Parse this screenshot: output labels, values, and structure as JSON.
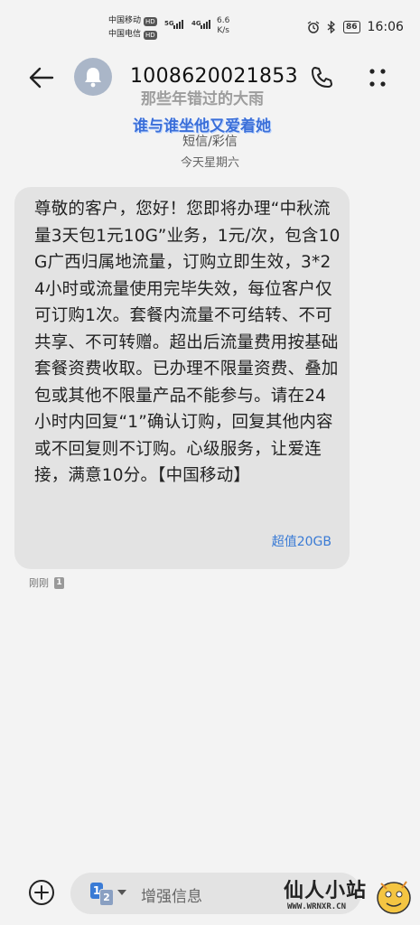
{
  "status_bar": {
    "carrier_1": "中国移动",
    "carrier_2": "中国电信",
    "hd_badge": "HD",
    "network_5g": "5G",
    "network_4g": "4G",
    "speed_value": "6.6",
    "speed_unit": "K/s",
    "battery_level": "86",
    "time": "16:06"
  },
  "header": {
    "phone_number": "1008620021853",
    "watermark_line1": "那些年错过的大雨",
    "watermark_line2": "谁与谁坐他又爱着她",
    "subtitle": "短信/彩信",
    "day_label": "今天星期六"
  },
  "message": {
    "text": "尊敬的客户，您好！您即将办理“中秋流量3天包1元10G”业务，1元/次，包含10G广西归属地流量，订购立即生效，3*24小时或流量使用完毕失效，每位客户仅可订购1次。套餐内流量不可结转、不可共享、不可转赠。超出后流量费用按基础套餐资费收取。已办理不限量资费、叠加包或其他不限量产品不能参与。请在24小时内回复“1”确认订购，回复其他内容或不回复则不订购。心级服务，让爱连接，满意10分。【中国移动】",
    "link_text": "超值20GB",
    "timestamp": "刚刚",
    "sim_slot": "1"
  },
  "compose": {
    "placeholder": "增强信息",
    "sim_1": "1",
    "sim_2": "2"
  },
  "watermark_logo": {
    "name": "仙人小站",
    "url": "WWW.WRNXR.CN"
  },
  "colors": {
    "background": "#f3f3f3",
    "bubble": "#e3e3e3",
    "link": "#3a7bd5",
    "avatar": "#aab6c8"
  },
  "icons": [
    "back-arrow-icon",
    "contact-avatar-icon",
    "phone-icon",
    "more-vertical-icon",
    "add-icon",
    "sim-select-icon",
    "chevron-down-icon"
  ]
}
